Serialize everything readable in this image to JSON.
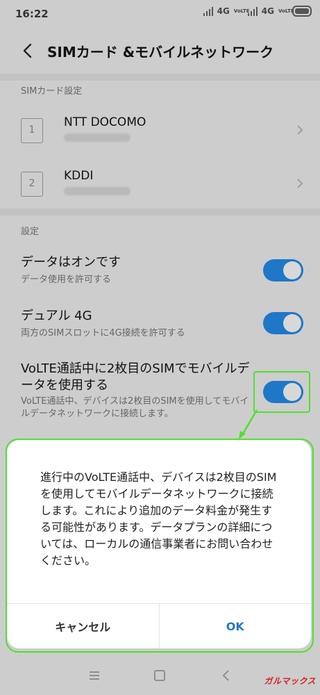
{
  "status": {
    "time": "16:22",
    "net1": "4G",
    "net2": "4G",
    "volte": "VoLTE"
  },
  "header": {
    "title": "SIMカード &モバイルネットワーク"
  },
  "sim_section": {
    "label": "SIMカード設定",
    "cards": [
      {
        "slot": "1",
        "name": "NTT DOCOMO"
      },
      {
        "slot": "2",
        "name": "KDDI"
      }
    ]
  },
  "settings_section": {
    "label": "設定",
    "items": [
      {
        "title": "データはオンです",
        "subtitle": "データ使用を許可する",
        "on": true
      },
      {
        "title": "デュアル 4G",
        "subtitle": "両方のSIMスロットに4G接続を許可する",
        "on": true
      },
      {
        "title": "VoLTE通話中に2枚目のSIMでモバイルデータを使用する",
        "subtitle": "VoLTE通話中、デバイスは2枚目のSIMを使用してモバイルデータネットワークに接続します。",
        "on": true
      }
    ]
  },
  "dialog": {
    "message": "進行中のVoLTE通話中、デバイスは2枚目のSIMを使用してモバイルデータネットワークに接続します。これにより追加のデータ料金が発生する可能性があります。データプランの詳細については、ローカルの通信事業者にお問い合わせください。",
    "cancel_label": "キャンセル",
    "ok_label": "OK"
  },
  "watermark": "ガルマックス",
  "colors": {
    "accent": "#1f77c8",
    "highlight": "#4ee12c",
    "overlay": "#cdcdcd"
  }
}
